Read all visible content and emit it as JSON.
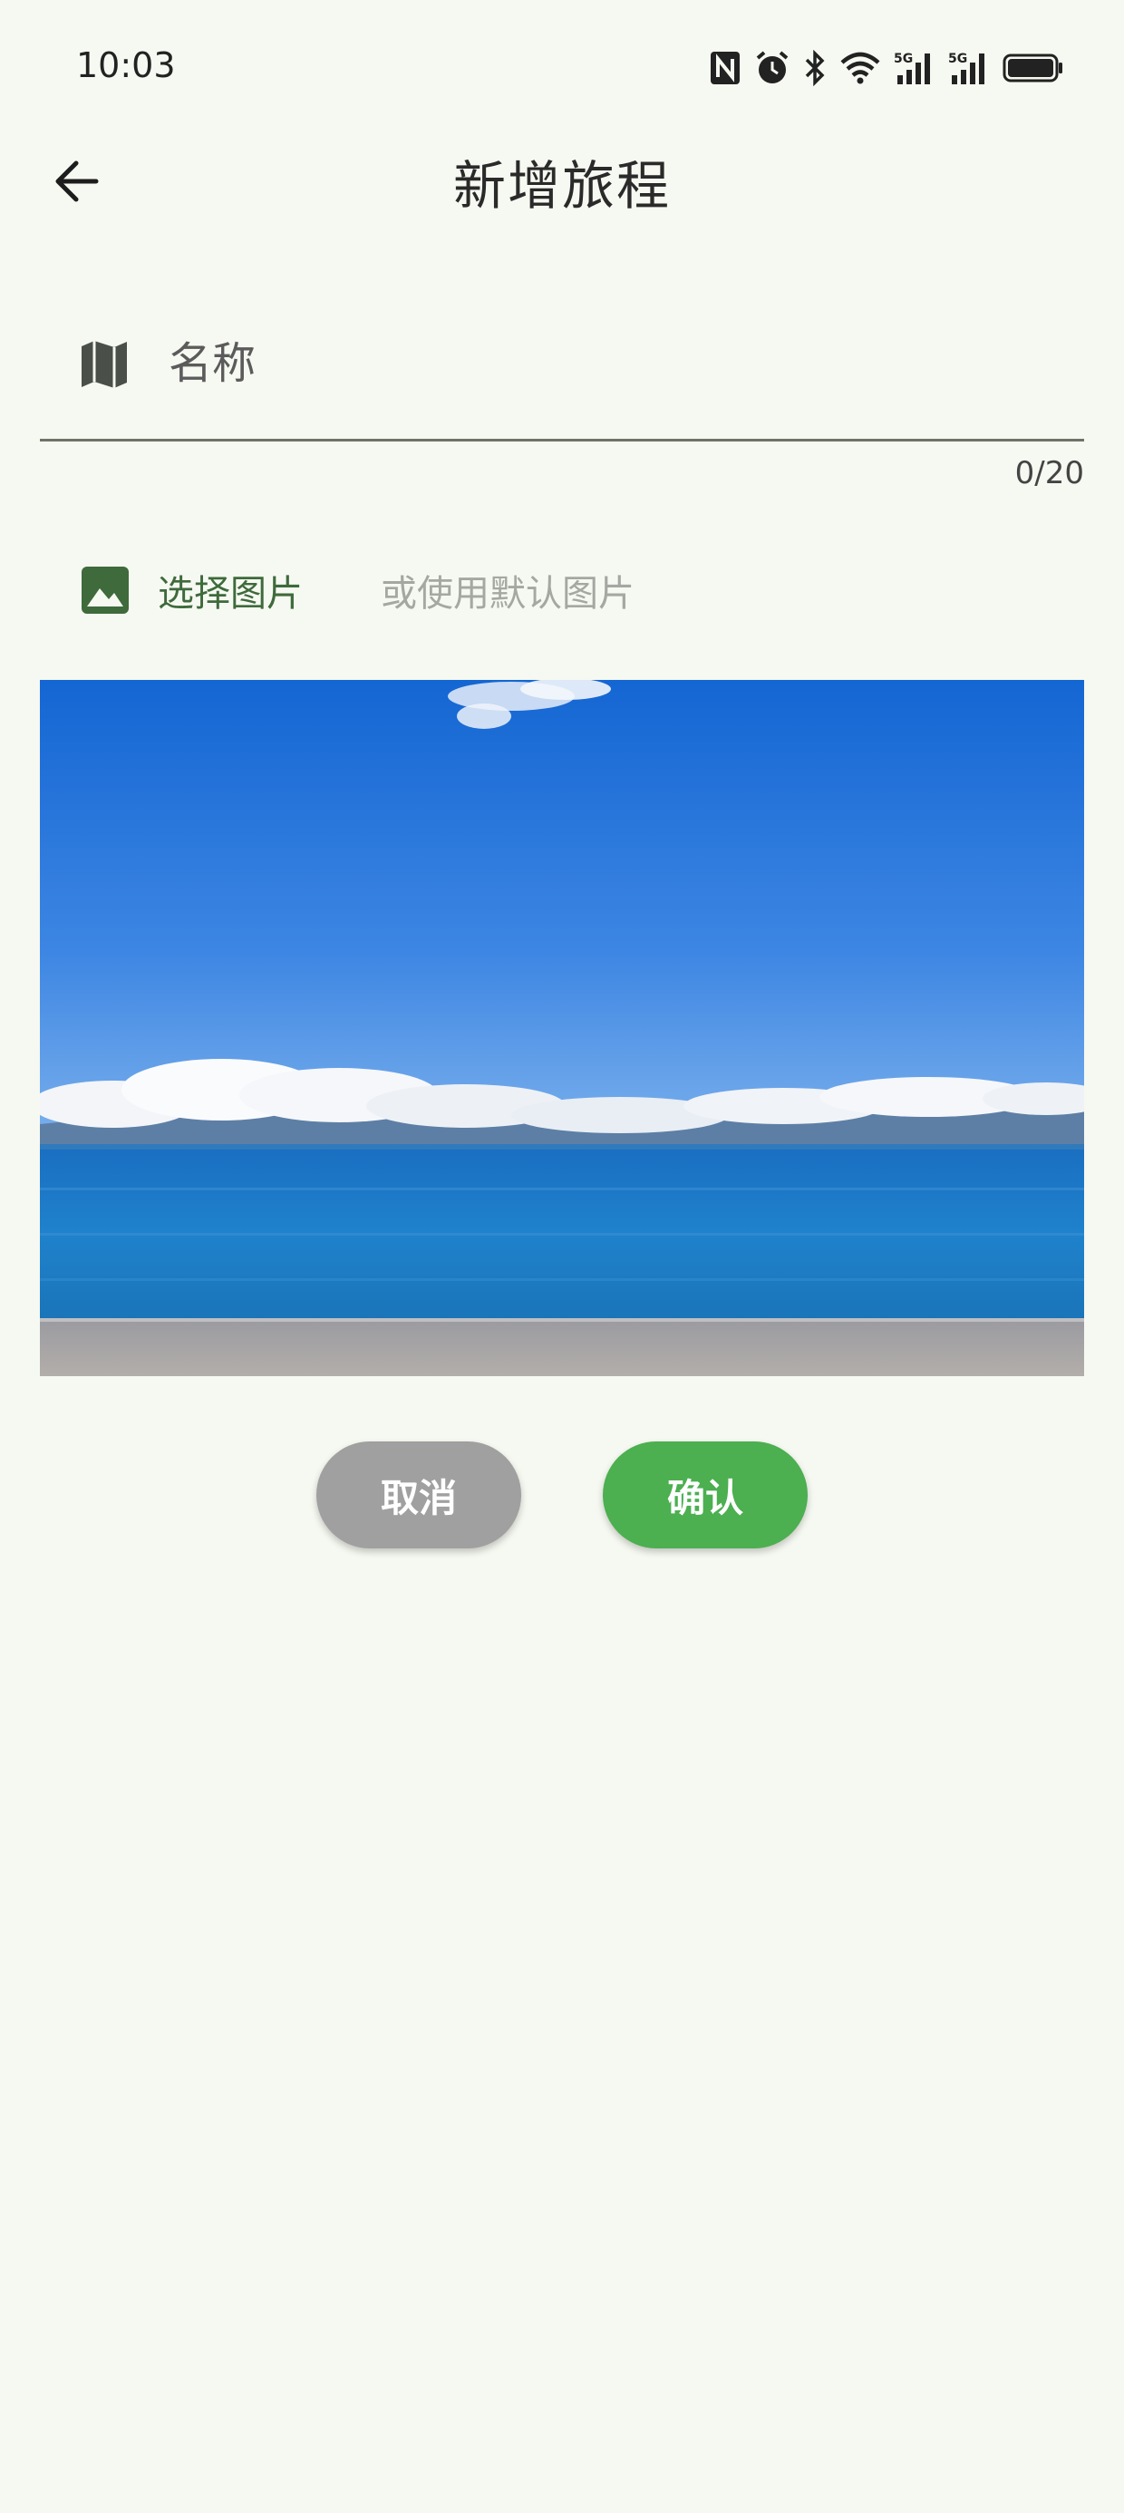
{
  "status_bar": {
    "time": "10:03",
    "icons": [
      "nfc-icon",
      "alarm-icon",
      "bluetooth-icon",
      "wifi-icon",
      "signal-5g-icon",
      "signal-5g-icon",
      "battery-icon"
    ],
    "network_labels": [
      "5G",
      "5G"
    ]
  },
  "header": {
    "title": "新增旅程",
    "back_icon": "arrow-back-icon"
  },
  "name_field": {
    "icon": "map-icon",
    "placeholder": "名称",
    "value": "",
    "counter": "0/20"
  },
  "image_picker": {
    "icon": "image-icon",
    "select_label": "选择图片",
    "default_label": "或使用默认图片"
  },
  "actions": {
    "cancel_label": "取消",
    "confirm_label": "确认"
  },
  "colors": {
    "background": "#f6f9f1",
    "accent_green": "#4caf50",
    "picker_green": "#3e6a3c",
    "cancel_gray": "#a0a0a0"
  }
}
